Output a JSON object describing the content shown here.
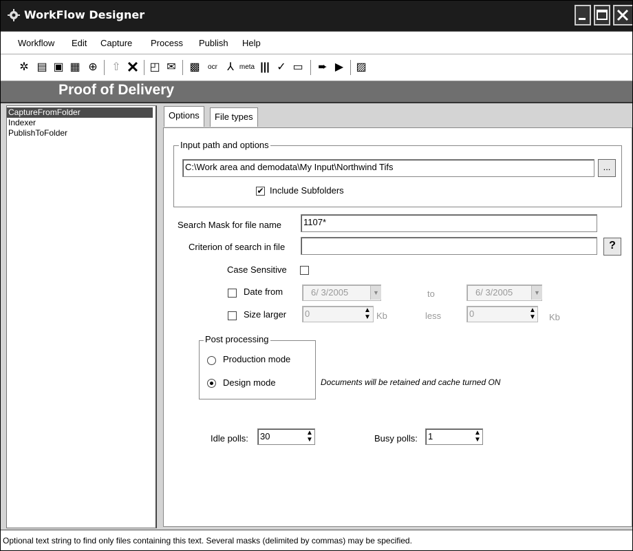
{
  "window": {
    "title": "WorkFlow Designer"
  },
  "menu": [
    "Workflow",
    "Edit",
    "Capture",
    "Process",
    "Publish",
    "Help"
  ],
  "banner": {
    "title": "Proof of Delivery"
  },
  "workflow_steps": [
    "CaptureFromFolder",
    "Indexer",
    "PublishToFolder"
  ],
  "tabs": [
    "Options",
    "File types"
  ],
  "input_group": {
    "legend": "Input path and options",
    "path_value": "C:\\Work area and demodata\\My Input\\Northwind Tifs",
    "browse_label": "...",
    "include_subfolders_label": "Include Subfolders",
    "include_subfolders_checked": true
  },
  "search": {
    "mask_label": "Search Mask for file name",
    "mask_value": "1107*",
    "criterion_label": "Criterion of search in file",
    "criterion_value": "",
    "help_label": "?",
    "case_sensitive_label": "Case Sensitive",
    "date_from_label": "Date from",
    "date_from_value": "6/ 3/2005",
    "date_to_label": "to",
    "date_to_value": "6/ 3/2005",
    "size_larger_label": "Size larger",
    "size_larger_value": "0",
    "size_unit_1": "Kb",
    "size_less_label": "less",
    "size_less_value": "0",
    "size_unit_2": "Kb"
  },
  "post_processing": {
    "legend": "Post processing",
    "production_label": "Production mode",
    "design_label": "Design mode",
    "selected": "Design mode",
    "note": "Documents will be retained and cache turned ON"
  },
  "polls": {
    "idle_label": "Idle polls:",
    "idle_value": "30",
    "busy_label": "Busy polls:",
    "busy_value": "1"
  },
  "status": "Optional text string to find only files containing this text. Several masks (delimited by commas) may be specified."
}
